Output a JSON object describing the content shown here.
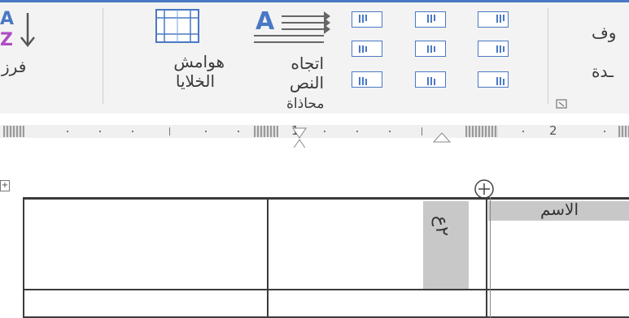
{
  "ribbon": {
    "sort_button": {
      "label": "فرز",
      "icon": "sort-az-icon"
    },
    "cell_margins_button": {
      "label_line1": "هوامش",
      "label_line2": "الخلايا",
      "icon": "cell-margins-icon"
    },
    "text_direction_button": {
      "label_line1": "اتجاه",
      "label_line2": "النص",
      "icon": "text-direction-icon"
    },
    "alignment_group": {
      "label": "محاذاة"
    },
    "cut_left": {
      "line1": "وف",
      "line2": "ـدة"
    }
  },
  "ruler": {
    "marks": [
      "1",
      "2"
    ]
  },
  "table": {
    "header_cell": "الاسم",
    "vertical_cell": "٢ع"
  },
  "colors": {
    "accent": "#4a78c4",
    "ribbon_bg": "#f3f3f3",
    "shade": "#c8c8c8"
  }
}
